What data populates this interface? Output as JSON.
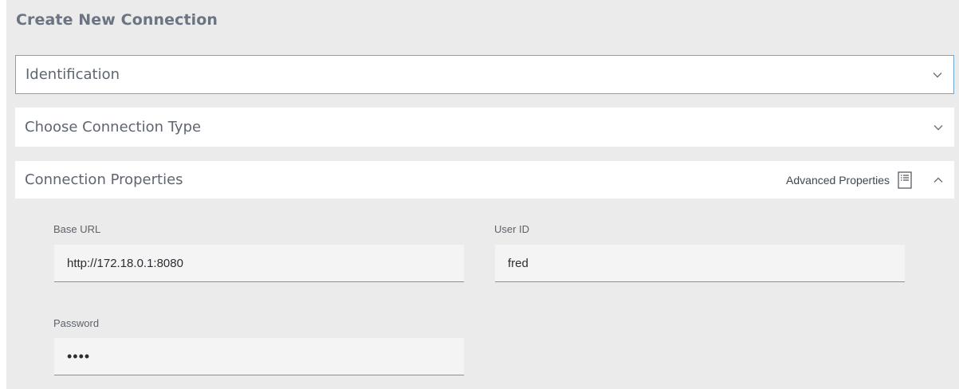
{
  "page": {
    "title": "Create New Connection"
  },
  "sections": {
    "identification": {
      "title": "Identification",
      "state": "collapsed"
    },
    "connection_type": {
      "title": "Choose Connection Type",
      "state": "collapsed"
    },
    "connection_properties": {
      "title": "Connection Properties",
      "state": "expanded",
      "advanced_label": "Advanced Properties",
      "advanced_icon": "list-details-icon"
    }
  },
  "fields": {
    "base_url": {
      "label": "Base URL",
      "value": "http://172.18.0.1:8080"
    },
    "user_id": {
      "label": "User ID",
      "value": "fred"
    },
    "password": {
      "label": "Password",
      "value": "••••"
    }
  },
  "colors": {
    "panel_bg": "#ebebeb",
    "section_bg": "#ffffff",
    "focus_border": "#6ea7d4",
    "title_text": "#6b7480",
    "field_bg": "#f4f4f4"
  }
}
